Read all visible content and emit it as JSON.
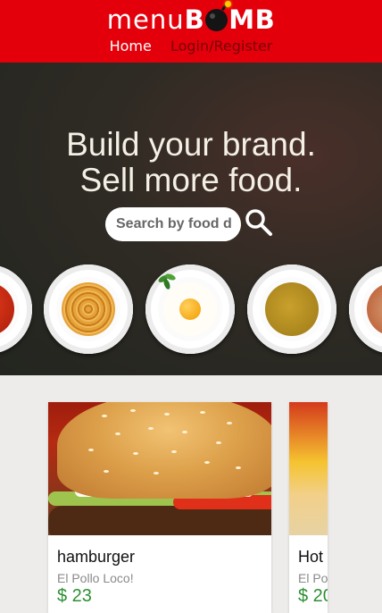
{
  "header": {
    "logo_light": "menu",
    "logo_bold_before": "B",
    "logo_bold_after": "MB",
    "brand_color": "#e3000b",
    "nav": {
      "home": "Home",
      "login": "Login/Register"
    }
  },
  "hero": {
    "title_line1": "Build your brand.",
    "title_line2": "Sell more food.",
    "search": {
      "placeholder": "Search by food d",
      "icon": "search-icon"
    },
    "plates": [
      {
        "name": "tomato-soup-plate"
      },
      {
        "name": "noodles-plate"
      },
      {
        "name": "fried-egg-plate"
      },
      {
        "name": "lentil-soup-plate"
      },
      {
        "name": "spread-plate"
      }
    ]
  },
  "items": [
    {
      "name": "hamburger",
      "restaurant": "El Pollo Loco!",
      "price": "$ 23"
    },
    {
      "name": "Hot",
      "restaurant": "El Po",
      "price": "$ 20"
    }
  ],
  "colors": {
    "price": "#2c8f32",
    "subtle_text": "#8a8a8a"
  }
}
